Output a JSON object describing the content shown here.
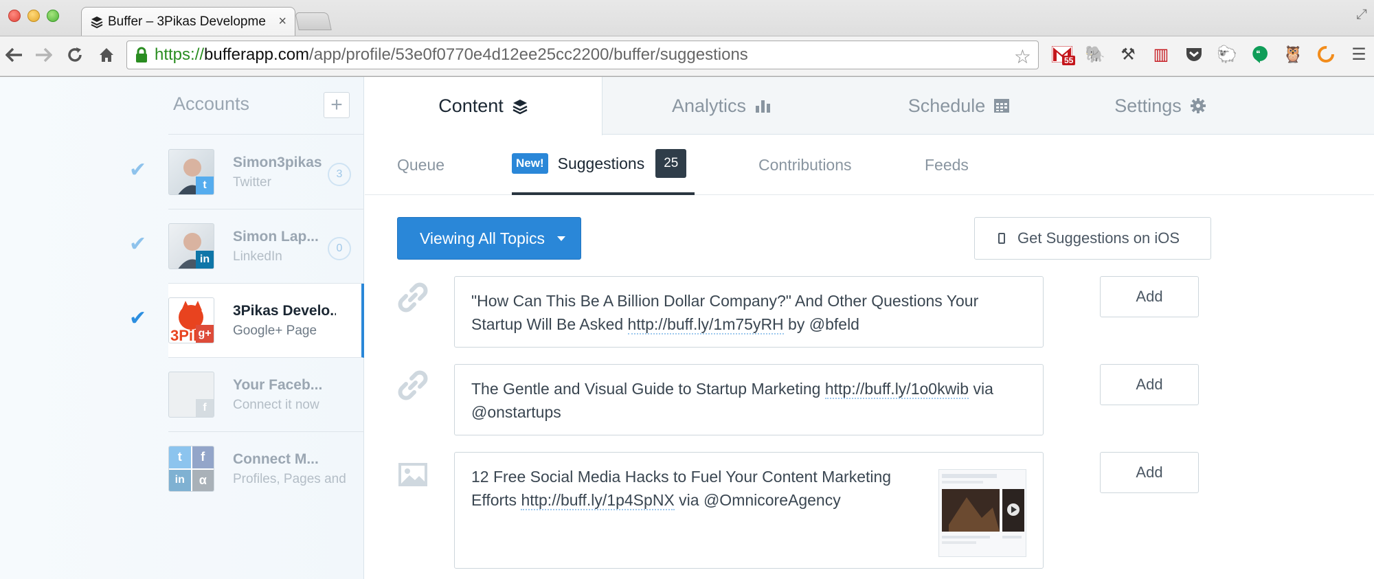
{
  "browser": {
    "tab_title": "Buffer – 3Pikas Developme",
    "url_scheme": "https://",
    "url_host": "bufferapp.com",
    "url_path": "/app/profile/53e0f0770e4d12ee25cc2200/buffer/suggestions",
    "gmail_badge": "55"
  },
  "sidebar": {
    "title": "Accounts",
    "add_label": "+",
    "accounts": [
      {
        "name": "Simon3pikas",
        "sub": "Twitter",
        "count": "3",
        "network": "twitter",
        "checked": true
      },
      {
        "name": "Simon Lap...",
        "sub": "LinkedIn",
        "count": "0",
        "network": "linkedin",
        "checked": true
      },
      {
        "name": "3Pikas Develo...",
        "sub": "Google+ Page",
        "count": "",
        "network": "google-plus",
        "checked": true,
        "active": true
      },
      {
        "name": "Your Faceb...",
        "sub": "Connect it now",
        "count": "",
        "network": "facebook",
        "checked": false
      },
      {
        "name": "Connect M...",
        "sub": "Profiles, Pages and",
        "count": "",
        "network": "multi",
        "checked": false
      }
    ]
  },
  "main_tabs": [
    {
      "label": "Content",
      "icon": "layers-icon",
      "active": true
    },
    {
      "label": "Analytics",
      "icon": "bar-chart-icon"
    },
    {
      "label": "Schedule",
      "icon": "calendar-icon"
    },
    {
      "label": "Settings",
      "icon": "gear-icon"
    }
  ],
  "sub_tabs": {
    "queue": "Queue",
    "new_badge": "New!",
    "suggestions": "Suggestions",
    "suggestions_count": "25",
    "contributions": "Contributions",
    "feeds": "Feeds"
  },
  "actions": {
    "topics_label": "Viewing All Topics",
    "ios_label": "Get Suggestions on iOS"
  },
  "suggestions": [
    {
      "type": "link",
      "text_before": "\"How Can This Be A Billion Dollar Company?\" And Other Questions Your Startup Will Be Asked ",
      "link": "http://buff.ly/1m75yRH",
      "text_after": " by @bfeld",
      "add_label": "Add"
    },
    {
      "type": "link",
      "text_before": "The Gentle and Visual Guide to Startup Marketing ",
      "link": "http://buff.ly/1o0kwib",
      "text_after": " via @onstartups",
      "add_label": "Add"
    },
    {
      "type": "image",
      "text_before": "12 Free Social Media Hacks to Fuel Your Content Marketing Efforts ",
      "link": "http://buff.ly/1p4SpNX",
      "text_after": " via @OmnicoreAgency",
      "add_label": "Add"
    }
  ],
  "colors": {
    "accent": "#2a87d8",
    "dark": "#2f3d49",
    "sidebar_bg": "#f4f8fc"
  }
}
